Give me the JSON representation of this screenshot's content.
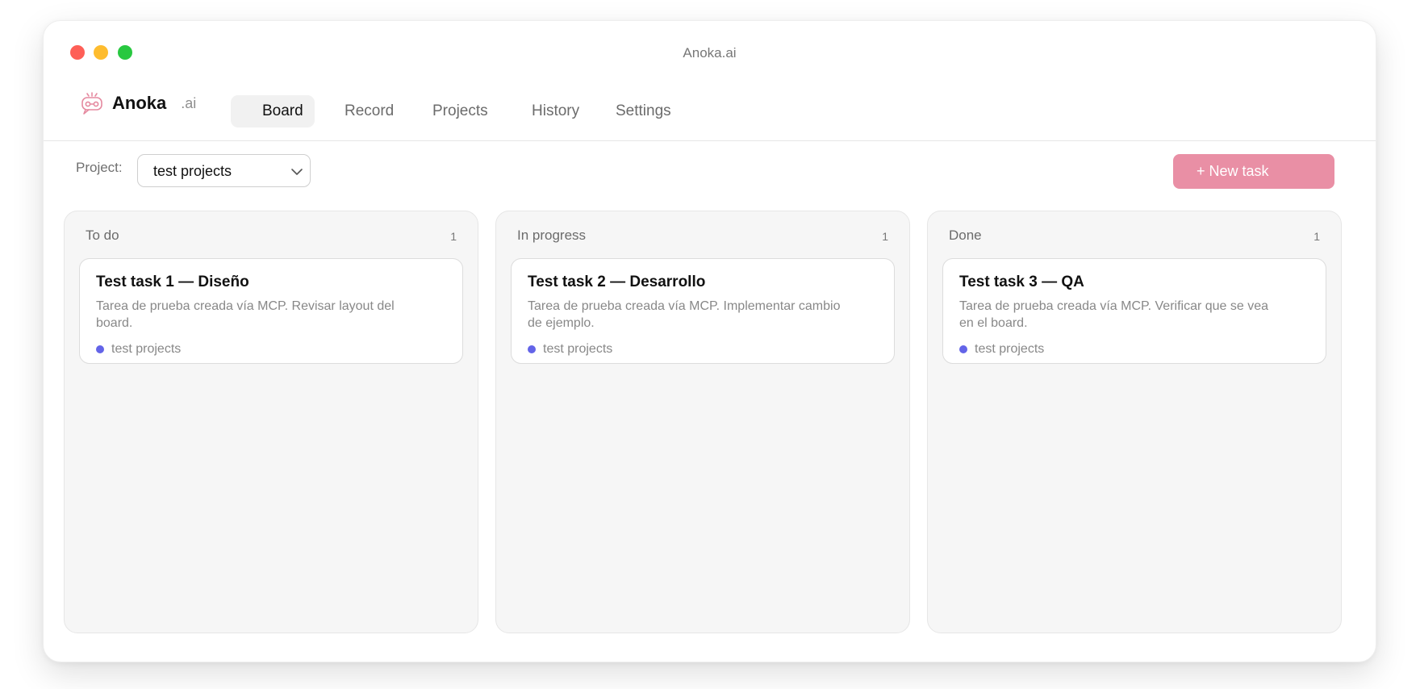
{
  "window": {
    "title": "Anoka.ai"
  },
  "brand": {
    "name": "Anoka",
    "suffix": ".ai",
    "icon": "robot-logo-icon",
    "color": "#e58aa0"
  },
  "nav": {
    "tabs": [
      {
        "label": "Board",
        "active": true
      },
      {
        "label": "Record",
        "active": false
      },
      {
        "label": "Projects",
        "active": false
      },
      {
        "label": "History",
        "active": false
      },
      {
        "label": "Settings",
        "active": false
      }
    ]
  },
  "toolbar": {
    "project_label": "Project:",
    "project_value": "test projects",
    "new_task_label": "+ New task",
    "new_task_color": "#e98fa5"
  },
  "board": {
    "columns": [
      {
        "title": "To do",
        "count": "1",
        "cards": [
          {
            "title": "Test task 1 — Diseño",
            "description": "Tarea de prueba creada vía MCP. Revisar layout del board.",
            "project": "test projects",
            "dot_color": "#6364e8"
          }
        ]
      },
      {
        "title": "In progress",
        "count": "1",
        "cards": [
          {
            "title": "Test task 2 — Desarrollo",
            "description": "Tarea de prueba creada vía MCP. Implementar cambio de ejemplo.",
            "project": "test projects",
            "dot_color": "#6364e8"
          }
        ]
      },
      {
        "title": "Done",
        "count": "1",
        "cards": [
          {
            "title": "Test task 3 — QA",
            "description": "Tarea de prueba creada vía MCP. Verificar que se vea en el board.",
            "project": "test projects",
            "dot_color": "#6364e8"
          }
        ]
      }
    ]
  }
}
